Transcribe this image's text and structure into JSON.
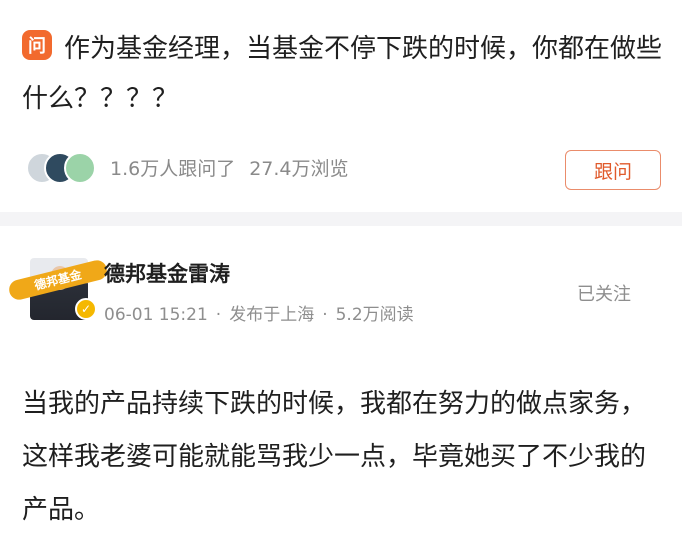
{
  "question": {
    "badge": "问",
    "title": "作为基金经理，当基金不停下跌的时候，你都在做些什么？？？？",
    "followers": "1.6万人跟问了",
    "views": "27.4万浏览",
    "follow_button": "跟问"
  },
  "answer": {
    "avatar_tag": "德邦基金",
    "author": "德邦基金雷涛",
    "time": "06-01 15:21",
    "location": "发布于上海",
    "reads": "5.2万阅读",
    "dot": "·",
    "followed_label": "已关注",
    "text": "当我的产品持续下跌的时候，我都在努力的做点家务，这样我老婆可能就能骂我少一点，毕竟她买了不少我的产品。"
  },
  "colors": {
    "accent": "#f26a2e",
    "follow_border": "#ea8c6b",
    "verified": "#f5b800",
    "tag": "#f0a818"
  }
}
